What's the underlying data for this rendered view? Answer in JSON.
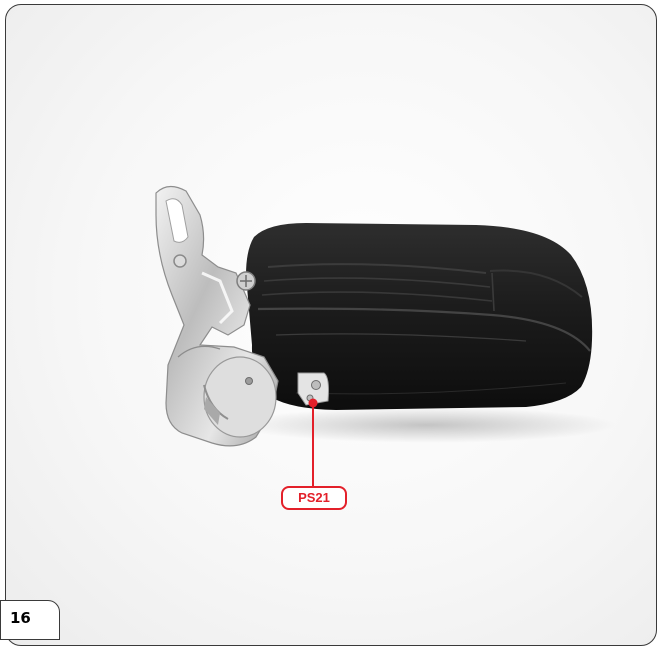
{
  "page": {
    "number": "16"
  },
  "callout": {
    "label": "PS21",
    "color": "#e3202a"
  },
  "photo": {
    "subject_icon": "seat-backrest-assembly",
    "bracket_color": "#c9c9c9",
    "cushion_color": "#1b1b1b"
  }
}
